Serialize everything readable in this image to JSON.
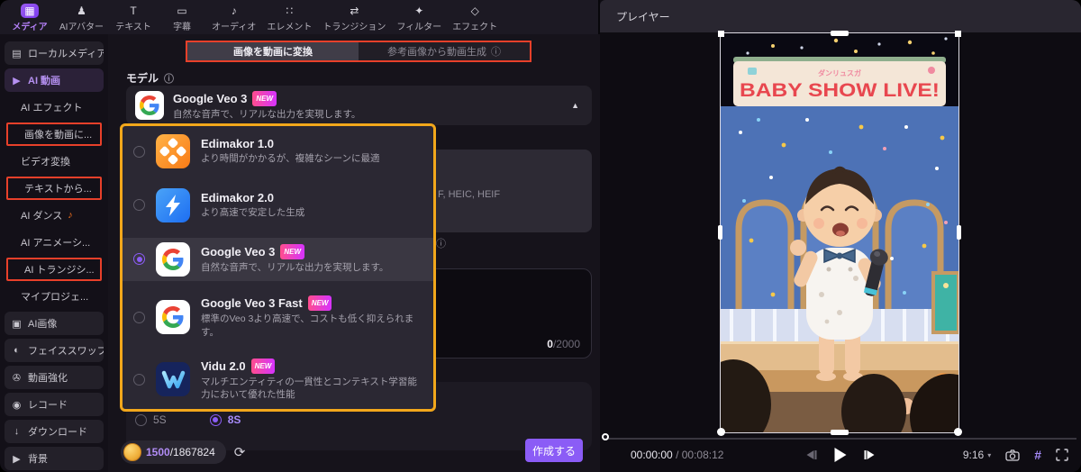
{
  "colors": {
    "accent": "#8b5cf6",
    "accent_light": "#a78bfa",
    "annotation_red": "#e8402a",
    "dropdown_border": "#f2a71b",
    "badge_pink_1": "#ff4d8d",
    "badge_pink_2": "#d633ff",
    "banner_red": "#e8474f",
    "coin_gold": "#f0b13c"
  },
  "icons": {
    "info": "ⓘ",
    "collapse": "▲",
    "caret": "▾",
    "refresh": "⟳",
    "dancer": "♪",
    "grid": "#"
  },
  "toolbar": {
    "items": [
      {
        "icon": "▦",
        "label": "メディア"
      },
      {
        "icon": "♟",
        "label": "AIアバター"
      },
      {
        "icon": "T",
        "label": "テキスト"
      },
      {
        "icon": "▭",
        "label": "字幕"
      },
      {
        "icon": "♪",
        "label": "オーディオ"
      },
      {
        "icon": "∷",
        "label": "エレメント"
      },
      {
        "icon": "⇄",
        "label": "トランジション"
      },
      {
        "icon": "✦",
        "label": "フィルター"
      },
      {
        "icon": "◇",
        "label": "エフェクト"
      }
    ]
  },
  "sidebar": {
    "items": [
      {
        "icon": "▤",
        "label": "ローカルメディア"
      },
      {
        "icon": "▶",
        "label": "AI 動画"
      },
      {
        "icon": "",
        "label": "AI エフェクト"
      },
      {
        "icon": "",
        "label": "画像を動画に..."
      },
      {
        "icon": "",
        "label": "ビデオ変換"
      },
      {
        "icon": "",
        "label": "テキストから..."
      },
      {
        "icon": "",
        "label": "AI ダンス"
      },
      {
        "icon": "",
        "label": "AI アニメーシ..."
      },
      {
        "icon": "",
        "label": "AI トランジシ..."
      },
      {
        "icon": "",
        "label": "マイプロジェ..."
      },
      {
        "icon": "▣",
        "label": "AI画像"
      },
      {
        "icon": "◐",
        "label": "フェイススワップ"
      },
      {
        "icon": "✇",
        "label": "動画強化"
      },
      {
        "icon": "◉",
        "label": "レコード"
      },
      {
        "icon": "↓",
        "label": "ダウンロード"
      },
      {
        "icon": "▶",
        "label": "背景"
      }
    ]
  },
  "main": {
    "tab_image_to_video": "画像を動画に変換",
    "tab_ref_image": "参考画像から動画生成",
    "model_label": "モデル",
    "selected_model": {
      "name": "Google Veo 3",
      "badge": "NEW",
      "desc": "自然な音声で、リアルな出力を実現します。"
    },
    "upload_formats_fragment": "F, HEIC, HEIF",
    "char_count": "0",
    "char_limit": "/2000",
    "duration_5s": "5S",
    "duration_8s": "8S",
    "credits_used": "1500",
    "credits_total": "/1867824",
    "create_button": "作成する",
    "dropdown": {
      "models": [
        {
          "name": "Edimakor 1.0",
          "desc": "より時間がかかるが、複雑なシーンに最適"
        },
        {
          "name": "Edimakor 2.0",
          "desc": "より高速で安定した生成"
        },
        {
          "name": "Google Veo 3",
          "badge": "NEW",
          "desc": "自然な音声で、リアルな出力を実現します。"
        },
        {
          "name": "Google Veo 3 Fast",
          "badge": "NEW",
          "desc": "標準のVeo 3より高速で、コストも低く抑えられます。"
        },
        {
          "name": "Vidu 2.0",
          "badge": "NEW",
          "desc": "マルチエンティティの一貫性とコンテキスト学習能力において優れた性能"
        }
      ]
    }
  },
  "player": {
    "title": "プレイヤー",
    "time_current": "00:00:00",
    "time_total": "/ 00:08:12",
    "aspect_ratio": "9:16",
    "canvas_image": {
      "banner_tagline": "ダンリュスガ",
      "banner_title": "BABY SHOW LIVE!"
    }
  }
}
